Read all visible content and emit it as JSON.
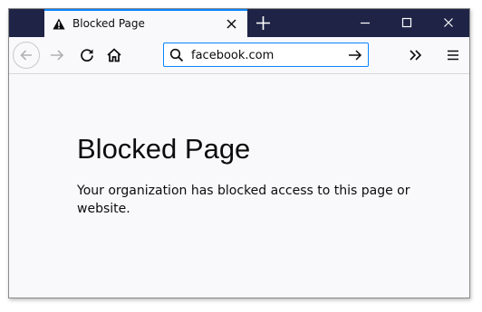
{
  "tab": {
    "title": "Blocked Page",
    "icon": "warning-icon"
  },
  "toolbar": {
    "url": "facebook.com"
  },
  "page": {
    "heading": "Blocked Page",
    "message": "Your organization has blocked access to this page or website."
  },
  "colors": {
    "titlebar": "#1f2447",
    "tab_accent": "#0a84ff",
    "urlbar_border": "#0a84ff",
    "content_background": "#f9f9fb"
  }
}
